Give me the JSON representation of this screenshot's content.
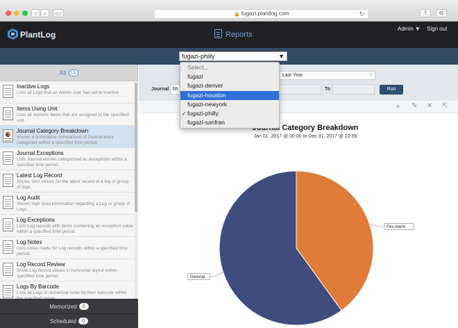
{
  "browser": {
    "url": "fugazi.plantlog.com"
  },
  "header": {
    "logo_text": "PlantLog",
    "reports_label": "Reports",
    "admin_label": "Admin ▼",
    "signout_label": "Sign out"
  },
  "location": {
    "selected": "fugazi-philly",
    "options": [
      {
        "label": "Select...",
        "placeholder": true
      },
      {
        "label": "fugazi"
      },
      {
        "label": "fugazi-denver"
      },
      {
        "label": "fugazi-houston",
        "highlighted": true
      },
      {
        "label": "fugazi-newyork"
      },
      {
        "label": "fugazi-philly",
        "checked": true
      },
      {
        "label": "fugazi-sanfran"
      }
    ]
  },
  "sidebar": {
    "all_label": "All",
    "all_count": "16",
    "memorized_label": "Memorized",
    "memorized_count": "0",
    "scheduled_label": "Scheduled",
    "scheduled_count": "0",
    "reports": [
      {
        "title": "Inactive Logs",
        "desc": "Lists all Logs that an Admin user has set to inactive."
      },
      {
        "title": "Items Using Unit",
        "desc": "Lists all numeric items that are assigned to the specified unit."
      },
      {
        "title": "Journal Category Breakdown",
        "desc": "Shows a cumulative comparison of Journal entry categories within a specified time period.",
        "active": true
      },
      {
        "title": "Journal Exceptions",
        "desc": "Lists Journal entries categorized as exceptions within a specified time period."
      },
      {
        "title": "Latest Log Record",
        "desc": "Shows item values for the latest record of a log or group of logs."
      },
      {
        "title": "Log Audit",
        "desc": "Shows high level information regarding a Log or group of Logs."
      },
      {
        "title": "Log Exceptions",
        "desc": "Lists Log records with items containing an exception value within a specified time period."
      },
      {
        "title": "Log Notes",
        "desc": "Lists notes made for Log records within a specified time period."
      },
      {
        "title": "Log Record Review",
        "desc": "Show Log record values in horizontal layout within specified time period."
      },
      {
        "title": "Logs By Barcode",
        "desc": "Lists all Logs in numerical order by their barcode within the specified group."
      }
    ]
  },
  "filters": {
    "period": "Last Year",
    "journal_label": "Journal",
    "journal_value": "Sh",
    "to_label": "To",
    "run_label": "Run"
  },
  "toolbar": {
    "icons": [
      "plus-icon",
      "pencil-icon",
      "close-icon",
      "export-icon"
    ]
  },
  "chart_data": {
    "type": "pie",
    "title": "Journal Category Breakdown",
    "subtitle": "Jan 01, 2017 @ 00:00 to Dec 31, 2017 @ 23:59",
    "slices": [
      {
        "label": "Fire Alarm",
        "value": 40,
        "color": "#e07b39"
      },
      {
        "label": "General",
        "value": 60,
        "color": "#3f4d7e"
      }
    ]
  }
}
